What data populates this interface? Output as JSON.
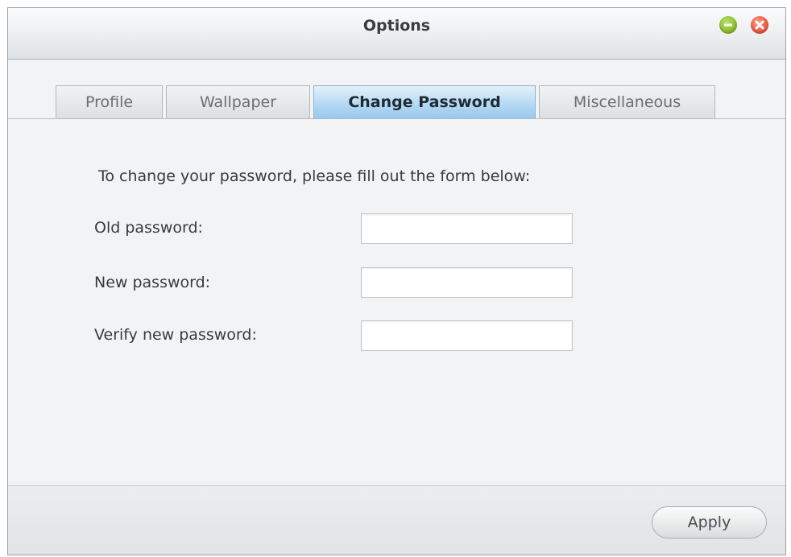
{
  "window": {
    "title": "Options",
    "controls": {
      "minimize_icon": "minimize-icon",
      "close_icon": "close-icon",
      "minimize_color": "#8dbf2c",
      "close_color": "#ec5a44"
    }
  },
  "tabs": [
    {
      "label": "Profile",
      "active": false
    },
    {
      "label": "Wallpaper",
      "active": false
    },
    {
      "label": "Change Password",
      "active": true
    },
    {
      "label": "Miscellaneous",
      "active": false
    }
  ],
  "form": {
    "intro": "To change your password, please fill out the form below:",
    "fields": [
      {
        "label": "Old password:",
        "value": "",
        "placeholder": ""
      },
      {
        "label": "New password:",
        "value": "",
        "placeholder": ""
      },
      {
        "label": "Verify new password:",
        "value": "",
        "placeholder": ""
      }
    ]
  },
  "footer": {
    "apply_label": "Apply"
  },
  "colors": {
    "active_tab": "#b5d9f3",
    "window_bg": "#f2f3f5"
  }
}
